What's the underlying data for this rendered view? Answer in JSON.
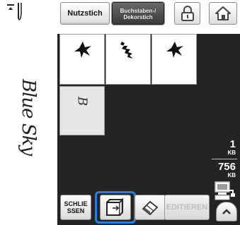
{
  "toolbar": {
    "needle_icon": "needle-position-icon",
    "normal_stitch_label": "Nutzstich",
    "letter_stitch_label_line1": "Buchstaben-/",
    "letter_stitch_label_line2": "Dekorstich",
    "lock_icon": "padlock-icon",
    "home_icon": "home-icon"
  },
  "preview": {
    "text": "Blue Sky"
  },
  "pattern_grid": {
    "cells": [
      {
        "icon": "star-stitch-icon"
      },
      {
        "icon": "feather-stitch-icon"
      },
      {
        "icon": "star-stitch-icon"
      },
      {
        "letter": "B"
      }
    ]
  },
  "memory": {
    "used_value": "1",
    "used_unit": "KB",
    "free_value": "756",
    "free_unit": "KB",
    "pc_icon": "computer-transfer-icon"
  },
  "bottom_bar": {
    "close_label_line1": "SCHLIE",
    "close_label_line2": "SSEN",
    "memory_icon": "pocket-memory-icon",
    "eraser_icon": "eraser-icon",
    "edit_label": "EDITIEREN",
    "up_icon": "chevron-up-icon"
  },
  "colors": {
    "highlight": "#2b7fd8",
    "edit_area": "#232323"
  }
}
